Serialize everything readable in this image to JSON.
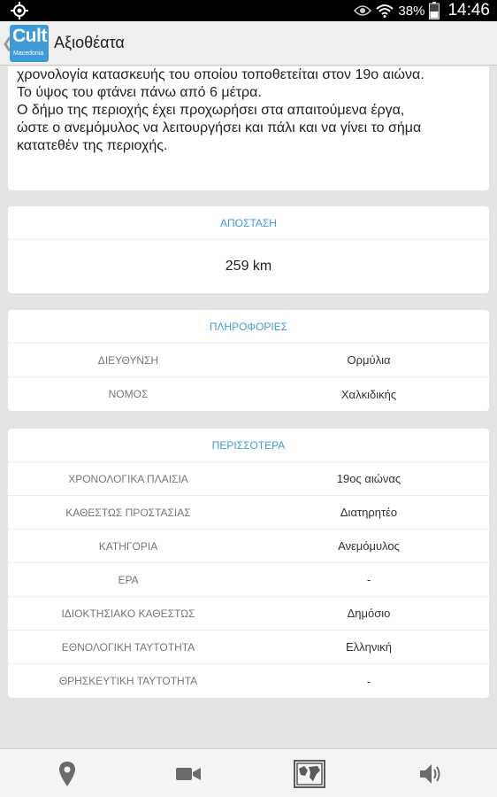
{
  "status_bar": {
    "battery": "38%",
    "time": "14:46"
  },
  "action_bar": {
    "logo_text": "Cult",
    "logo_subtext": "Macedonia",
    "title": "Αξιοθέατα"
  },
  "description": {
    "lines": [
      "χρονολογία κατασκευής του οποίου τοποθετείται στον 19ο αιώνα.",
      "Το ύψος του φτάνει πάνω από 6 μέτρα.",
      "Ο δήμο της περιοχής έχει προχωρήσει  στα απαιτούμενα έργα,",
      "ώστε ο ανεμόμυλος να λειτουργήσει και πάλι και να γίνει το σήμα",
      "κατατεθέν της περιοχής."
    ]
  },
  "distance": {
    "header": "ΑΠΟΣΤΑΣΗ",
    "value": "259 km"
  },
  "info": {
    "header": "ΠΛΗΡΟΦΟΡΙΕΣ",
    "rows": [
      {
        "label": "ΔΙΕΥΘΥΝΣΗ",
        "value": "Ορμύλια"
      },
      {
        "label": "ΝΟΜΟΣ",
        "value": "Χαλκιδικής"
      }
    ]
  },
  "more": {
    "header": "ΠΕΡΙΣΣΟΤΕΡΑ",
    "rows": [
      {
        "label": "ΧΡΟΝΟΛΟΓΙΚΑ ΠΛΑΙΣΙΑ",
        "value": "19ος αιώνας"
      },
      {
        "label": "ΚΑΘΕΣΤΩΣ ΠΡΟΣΤΑΣΙΑΣ",
        "value": "Διατηρητέο"
      },
      {
        "label": "ΚΑΤΗΓΟΡΙΑ",
        "value": "Ανεμόμυλος"
      },
      {
        "label": "ΕΡΑ",
        "value": "-"
      },
      {
        "label": "ΙΔΙΟΚΤΗΣΙΑΚΟ ΚΑΘΕΣΤΩΣ",
        "value": "Δημόσιο"
      },
      {
        "label": "ΕΘΝΟΛΟΓΙΚΗ ΤΑΥΤΟΤΗΤΑ",
        "value": "Ελληνική"
      },
      {
        "label": "ΘΡΗΣΚΕΥΤΙΚΗ ΤΑΥΤΟΤΗΤΑ",
        "value": "-"
      }
    ]
  },
  "bottom_nav": {
    "items": [
      {
        "icon": "map-pin-icon"
      },
      {
        "icon": "video-camera-icon"
      },
      {
        "icon": "photo-gallery-icon"
      },
      {
        "icon": "speaker-audio-icon"
      }
    ]
  },
  "colors": {
    "accent": "#3f9ad8",
    "background": "#e4e4e4",
    "card": "#ffffff"
  }
}
